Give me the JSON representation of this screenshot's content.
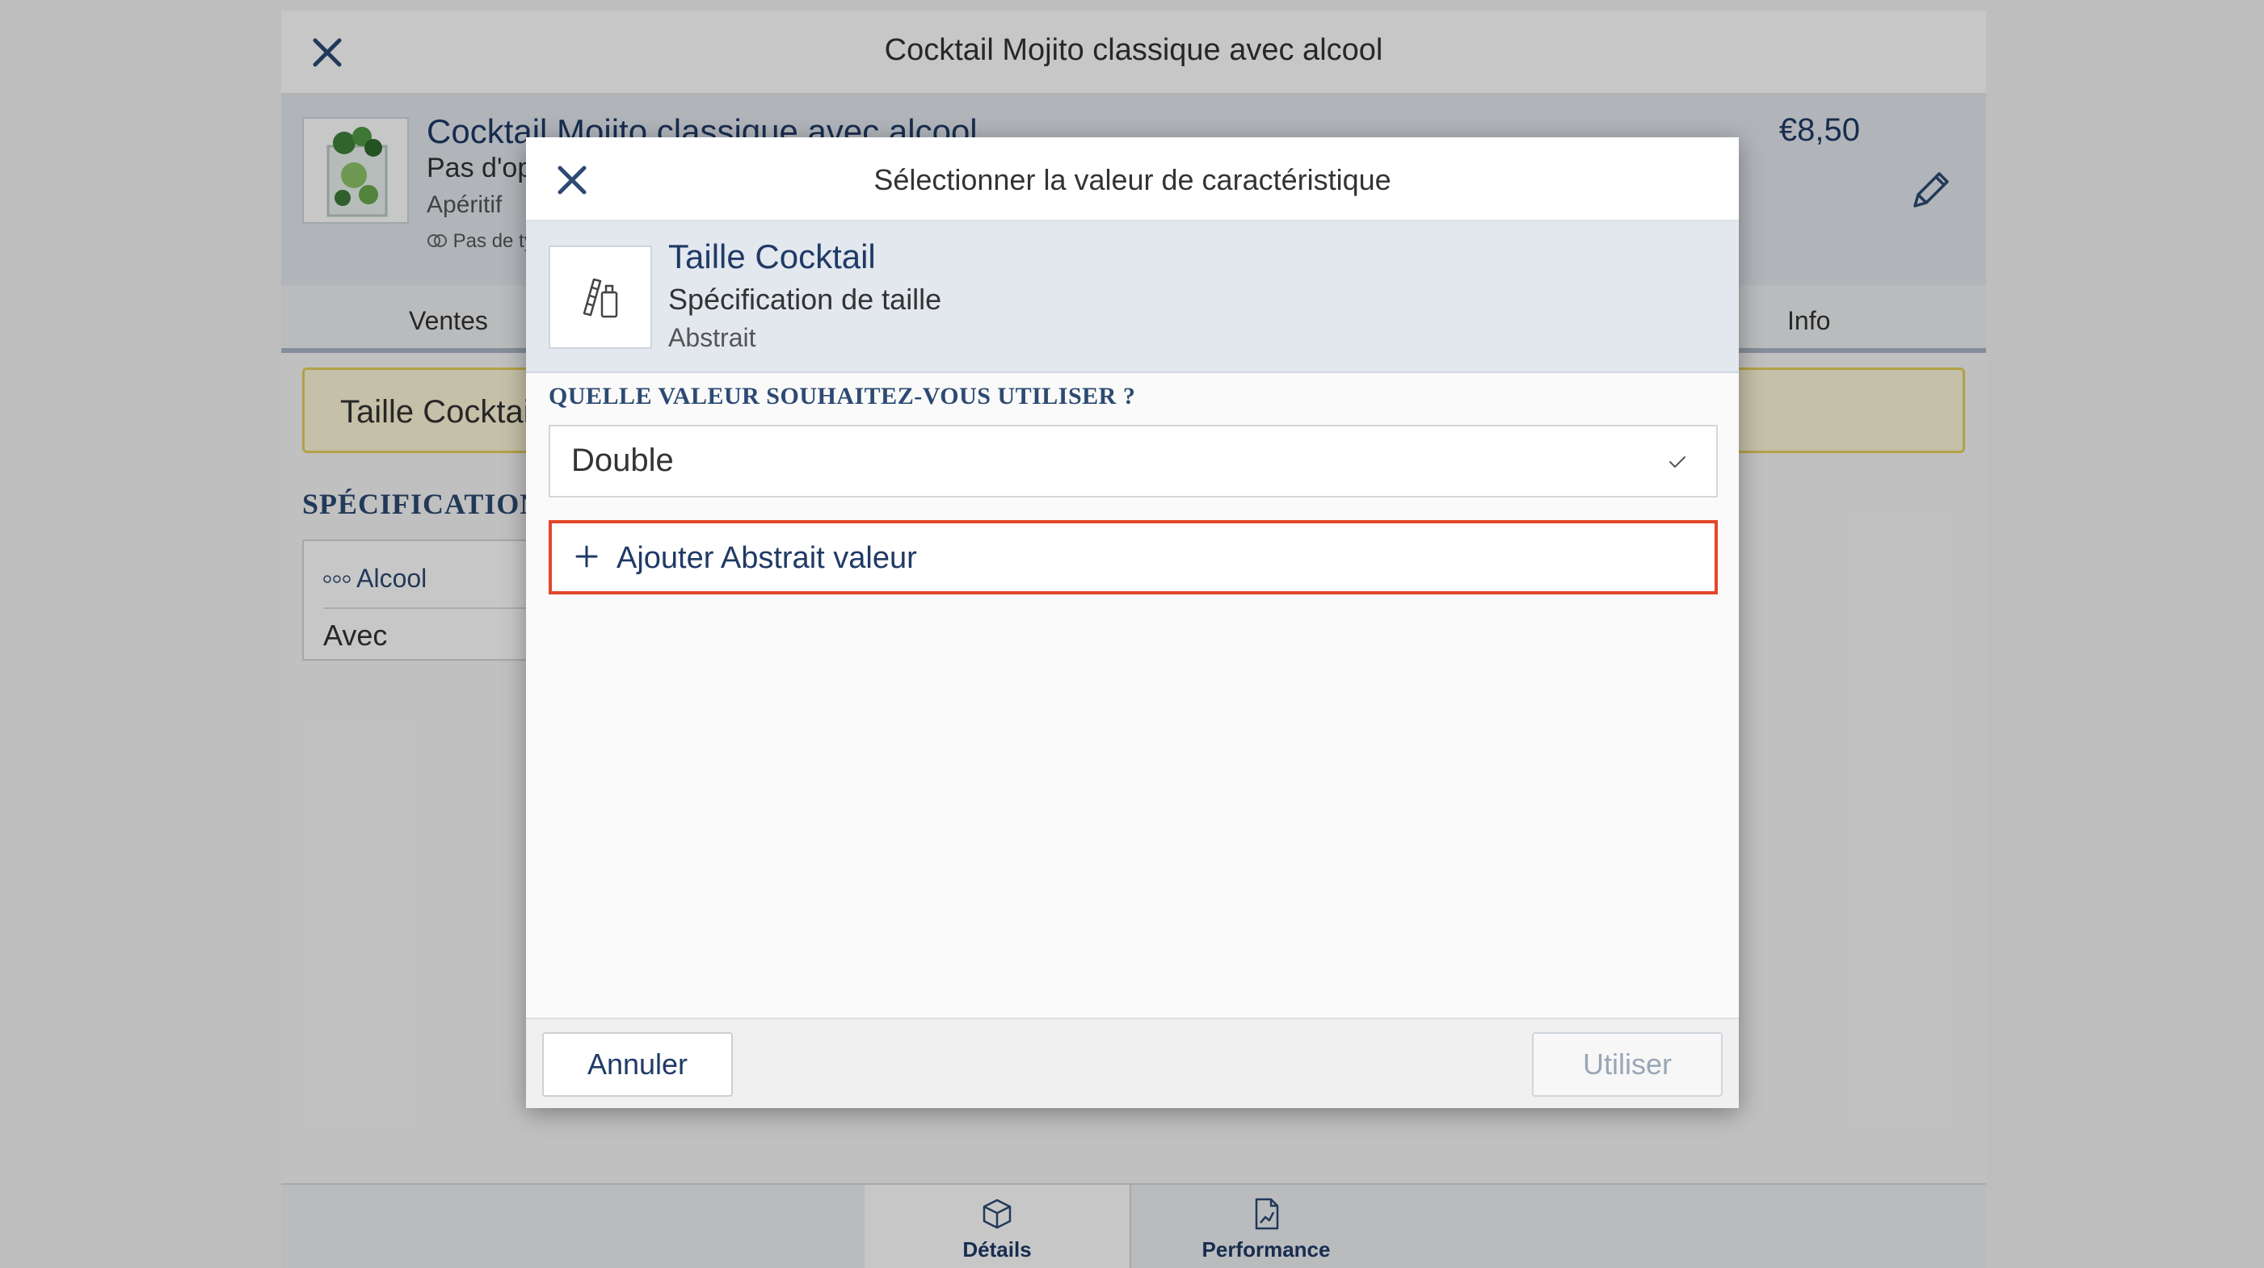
{
  "background": {
    "header_title": "Cocktail Mojito classique avec alcool",
    "product": {
      "name": "Cocktail Mojito classique avec alcool",
      "line1": "Pas d'op",
      "line2": "Apéritif",
      "line3": "Pas de ty",
      "price": "€8,50"
    },
    "tabs": [
      "Ventes",
      "Info"
    ],
    "banner_text": "Taille Cocktai",
    "spec_heading": "SPÉCIFICATIONS",
    "spec_card": {
      "label": "Alcool",
      "value": "Avec"
    },
    "bottom_tabs": [
      {
        "label": "Détails",
        "icon": "box-icon"
      },
      {
        "label": "Performance",
        "icon": "chart-icon"
      }
    ]
  },
  "modal": {
    "title": "Sélectionner la valeur de caractéristique",
    "feature": {
      "name": "Taille Cocktail",
      "subtitle": "Spécification de taille",
      "kind": "Abstrait"
    },
    "question": "QUELLE VALEUR SOUHAITEZ-VOUS UTILISER ?",
    "options": [
      {
        "label": "Double",
        "selected": true
      }
    ],
    "add_label": "Ajouter Abstrait valeur",
    "cancel_label": "Annuler",
    "use_label": "Utiliser"
  },
  "colors": {
    "accent": "#1f3a66",
    "highlight_border": "#e4462b",
    "banner_border": "#e6cf5a"
  }
}
